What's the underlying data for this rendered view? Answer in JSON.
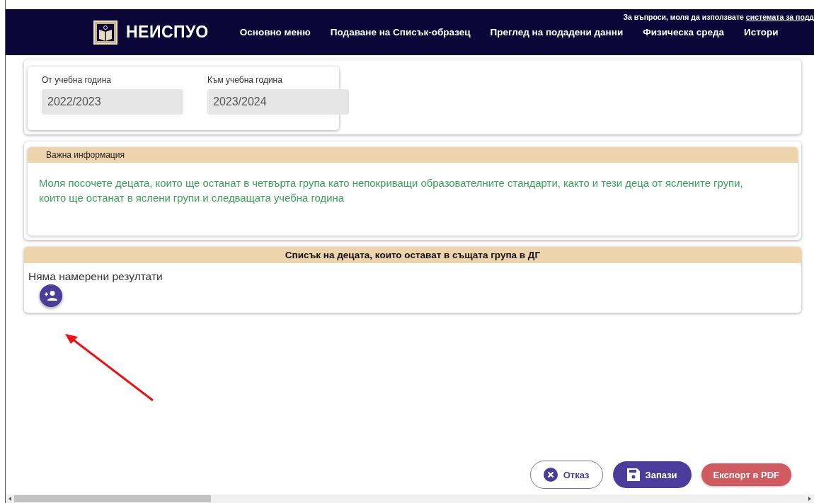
{
  "header": {
    "logo_text": "НЕИСПУО",
    "notice": {
      "text": "За въпроси, моля да използвате ",
      "link": "системата за подд"
    },
    "nav": [
      {
        "label": "Основно меню"
      },
      {
        "label": "Подаване на Списък-образец"
      },
      {
        "label": "Преглед на подадени данни"
      },
      {
        "label": "Физическа среда"
      },
      {
        "label": "Истори"
      }
    ]
  },
  "years": [
    {
      "label": "От учебна година",
      "value": "2022/2023",
      "disabled": true
    },
    {
      "label": "Към учебна година",
      "value": "2023/2024",
      "disabled": true
    }
  ],
  "info": {
    "title": "Важна информация",
    "text": "Моля посочете децата, които ще останат в четвърта група като непокриващи образователните стандарти, както и тези деца от яслените групи, които ще останат в яслени групи и следващата учебна година"
  },
  "list": {
    "title": "Списък на децата, които остават в същата група в ДГ",
    "empty_text": "Няма намерени резултати"
  },
  "buttons": [
    {
      "kind": "cancel",
      "label": "Отказ"
    },
    {
      "kind": "save",
      "label": "Запази"
    },
    {
      "kind": "export",
      "label": "Експорт в PDF"
    }
  ]
}
